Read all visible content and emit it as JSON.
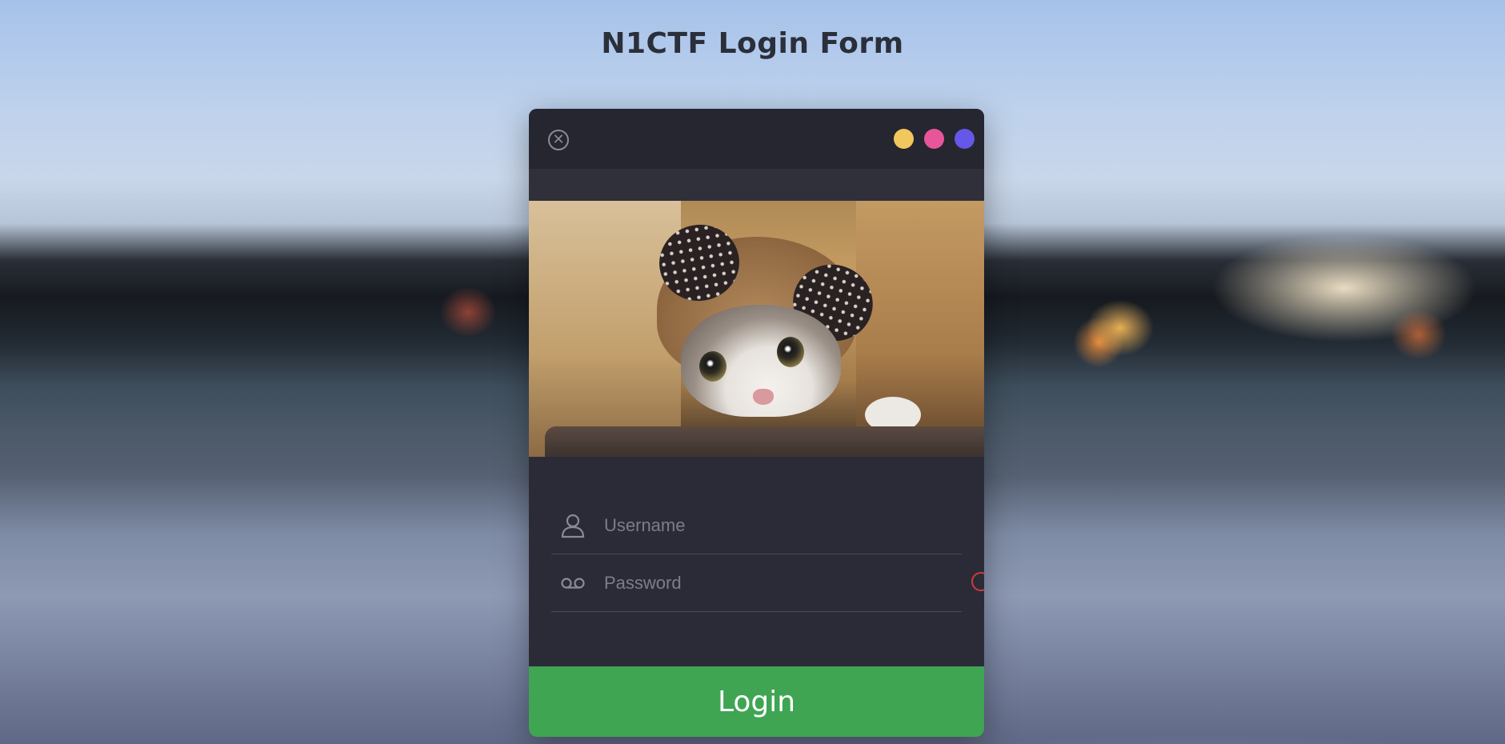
{
  "page": {
    "title": "N1CTF Login Form"
  },
  "window": {
    "close_icon": "close-circle-icon",
    "dot_colors": [
      "#f2c75c",
      "#e9559a",
      "#6557e8"
    ]
  },
  "hero": {
    "image": "kitten-in-bear-hat"
  },
  "form": {
    "username": {
      "placeholder": "Username",
      "value": "",
      "icon": "user-icon"
    },
    "password": {
      "placeholder": "Password",
      "value": "",
      "icon": "voicemail-icon"
    },
    "login_label": "Login"
  },
  "colors": {
    "card_bg": "#2b2b37",
    "login_green": "#3fa553",
    "indicator_red": "#d03a3a"
  }
}
